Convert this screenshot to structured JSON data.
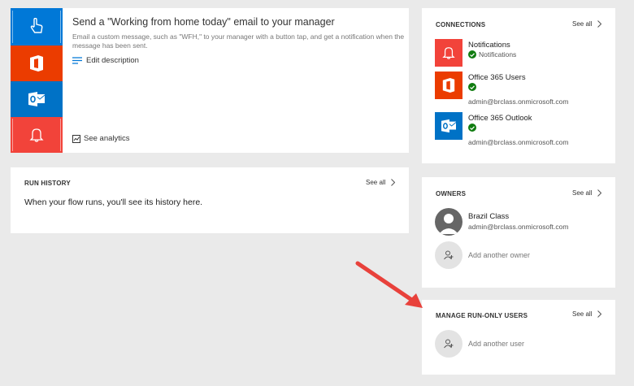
{
  "flow": {
    "title": "Send a \"Working from home today\" email to your manager",
    "description": "Email a custom message, such as \"WFH,\" to your manager with a button tap, and get a notification when the message has been sent.",
    "edit_label": "Edit description",
    "analytics_label": "See analytics",
    "tiles": [
      "touch-icon",
      "office-icon",
      "outlook-icon",
      "bell-icon"
    ]
  },
  "run_history": {
    "title": "RUN HISTORY",
    "see_all": "See all",
    "empty_message": "When your flow runs, you'll see its history here."
  },
  "connections": {
    "title": "CONNECTIONS",
    "see_all": "See all",
    "items": [
      {
        "name": "Notifications",
        "sub": "Notifications",
        "email": "",
        "color": "#f2433a",
        "icon": "bell-icon"
      },
      {
        "name": "Office 365 Users",
        "sub": "",
        "email": "admin@brclass.onmicrosoft.com",
        "color": "#eb3c00",
        "icon": "office-icon"
      },
      {
        "name": "Office 365 Outlook",
        "sub": "",
        "email": "admin@brclass.onmicrosoft.com",
        "color": "#0072c6",
        "icon": "outlook-icon"
      }
    ]
  },
  "owners": {
    "title": "OWNERS",
    "see_all": "See all",
    "owner_name": "Brazil Class",
    "owner_email": "admin@brclass.onmicrosoft.com",
    "add_label": "Add another owner"
  },
  "run_only": {
    "title": "MANAGE RUN-ONLY USERS",
    "see_all": "See all",
    "add_label": "Add another user"
  },
  "annotation": {
    "arrow_color": "#e8413b"
  }
}
